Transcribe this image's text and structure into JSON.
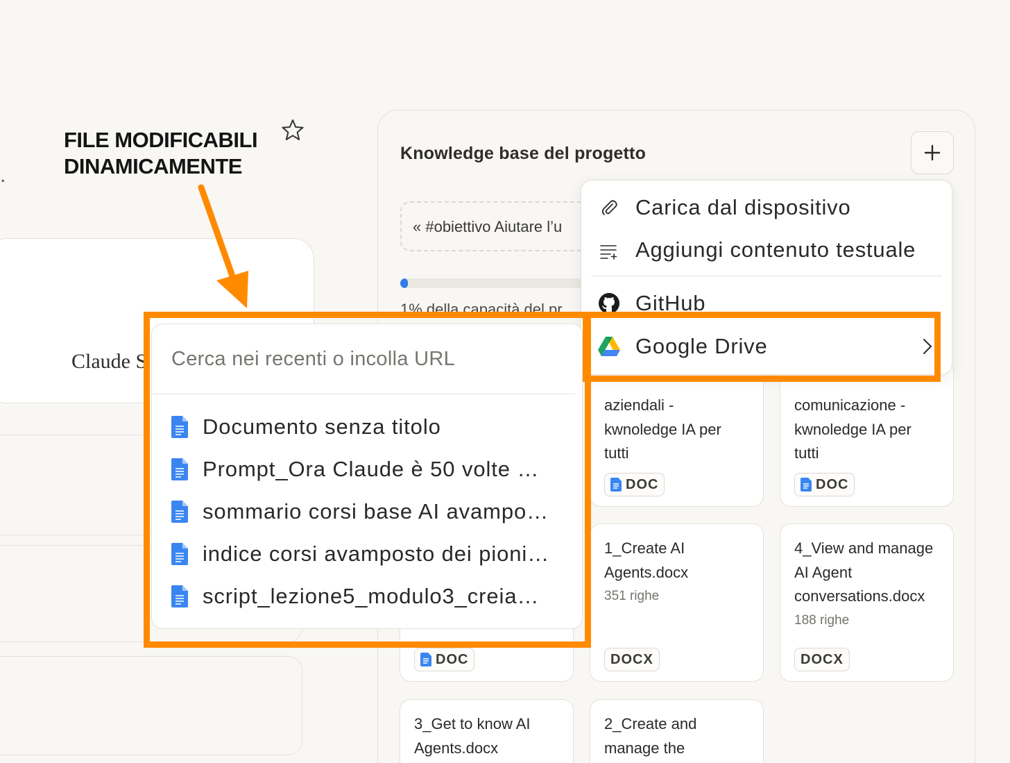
{
  "annotation": {
    "line1": "FILE MODIFICABILI",
    "line2": "DINAMICAMENTE",
    "accent": "#ff8a00"
  },
  "left": {
    "dot": ".",
    "claude_text": "Claude S"
  },
  "knowledge": {
    "title": "Knowledge base del progetto",
    "add_icon": "plus-icon",
    "instructions_preview": "« #obiettivo Aiutare l’u",
    "capacity_text": "1% della capacità del pr",
    "capacity_percent": 1
  },
  "menu": {
    "items": [
      {
        "label": "Carica dal dispositivo",
        "icon": "paperclip-icon"
      },
      {
        "label": "Aggiungi contenuto testuale",
        "icon": "text-add-icon"
      },
      {
        "label": "GitHub",
        "icon": "github-icon"
      },
      {
        "label": "Google Drive",
        "icon": "google-drive-icon"
      }
    ]
  },
  "drive": {
    "search_placeholder": "Cerca nei recenti o incolla URL",
    "files": [
      "Documento senza titolo",
      "Prompt_Ora Claude è 50 volte …",
      "sommario corsi base AI avampo…",
      "indice corsi avamposto dei pioni…",
      "script_lezione5_modulo3_creia…"
    ]
  },
  "files": [
    {
      "name_lines": [
        "aziendali -",
        "kwnoledge IA per",
        "tutti"
      ],
      "type": "DOC"
    },
    {
      "name_lines": [
        "comunicazione -",
        "kwnoledge IA per",
        "tutti"
      ],
      "type": "DOC"
    },
    {
      "type": "DOC"
    },
    {
      "name_lines": [
        "1_Create AI",
        "Agents.docx"
      ],
      "lines": "351 righe",
      "type": "DOCX"
    },
    {
      "name_lines": [
        "4_View and manage",
        "AI Agent",
        "conversations.docx"
      ],
      "lines": "188 righe",
      "type": "DOCX"
    },
    {
      "name_lines": [
        "3_Get to know AI",
        "Agents.docx"
      ]
    },
    {
      "name_lines": [
        "2_Create and",
        "manage the"
      ]
    }
  ]
}
